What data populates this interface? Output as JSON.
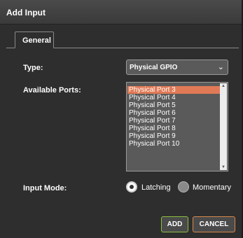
{
  "dialog": {
    "title": "Add Input"
  },
  "tabs": [
    {
      "label": "General",
      "active": true
    }
  ],
  "type": {
    "label": "Type:",
    "value": "Physical GPIO",
    "chevron_icon": "chevron-down-icon"
  },
  "ports": {
    "label": "Available Ports:",
    "items": [
      "Physical Port 3",
      "Physical Port 4",
      "Physical Port 5",
      "Physical Port 6",
      "Physical Port 7",
      "Physical Port 8",
      "Physical Port 9",
      "Physical Port 10"
    ],
    "selected_index": 0
  },
  "input_mode": {
    "label": "Input Mode:",
    "options": [
      "Latching",
      "Momentary"
    ],
    "selected": "Latching"
  },
  "buttons": {
    "add_label": "ADD",
    "cancel_label": "CANCEL"
  },
  "colors": {
    "dialog_bg": "#2e2e2e",
    "selection": "#e07a56",
    "add_border": "#8cc040",
    "cancel_border": "#d8874a"
  }
}
